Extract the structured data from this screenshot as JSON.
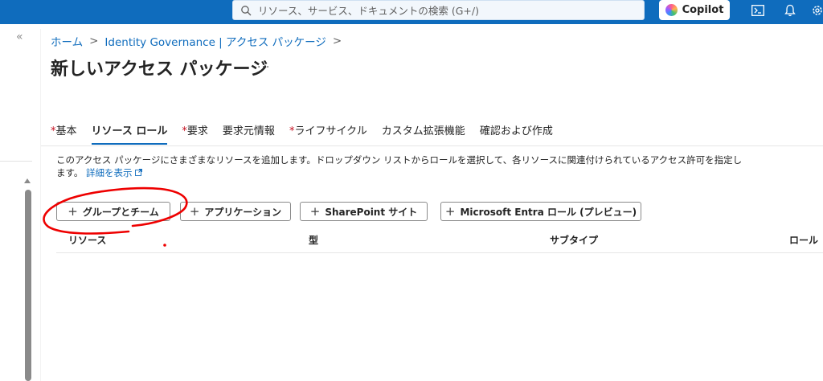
{
  "header": {
    "search_placeholder": "リソース、サービス、ドキュメントの検索 (G+/)",
    "copilot_label": "Copilot",
    "icons": [
      "search-icon",
      "copilot-icon",
      "cloud-shell-icon",
      "bell-icon",
      "settings-icon"
    ]
  },
  "sidebar": {
    "collapse_glyph": "«"
  },
  "breadcrumb": {
    "home": "ホーム",
    "parent": "Identity Governance | アクセス パッケージ",
    "separator": ">"
  },
  "page": {
    "title": "新しいアクセス パッケージ",
    "more": "..."
  },
  "tabs": [
    {
      "label": "基本",
      "required": true
    },
    {
      "label": "リソース ロール",
      "required": false,
      "active": true
    },
    {
      "label": "要求",
      "required": true
    },
    {
      "label": "要求元情報",
      "required": false
    },
    {
      "label": "ライフサイクル",
      "required": true
    },
    {
      "label": "カスタム拡張機能",
      "required": false
    },
    {
      "label": "確認および作成",
      "required": false
    }
  ],
  "description": {
    "text": "このアクセス パッケージにさまざまなリソースを追加します。ドロップダウン リストからロールを選択して、各リソースに関連付けられているアクセス許可を指定します。",
    "link": "詳細を表示"
  },
  "actions": {
    "groups_teams": "グループとチーム",
    "applications": "アプリケーション",
    "sharepoint": "SharePoint サイト",
    "entra_roles": "Microsoft Entra ロール (プレビュー)"
  },
  "table": {
    "columns": [
      "リソース",
      "型",
      "サブタイプ",
      "ロール"
    ]
  },
  "colors": {
    "accent": "#0f6cbd",
    "required": "#c50f1f",
    "annotation": "#ee0000"
  }
}
